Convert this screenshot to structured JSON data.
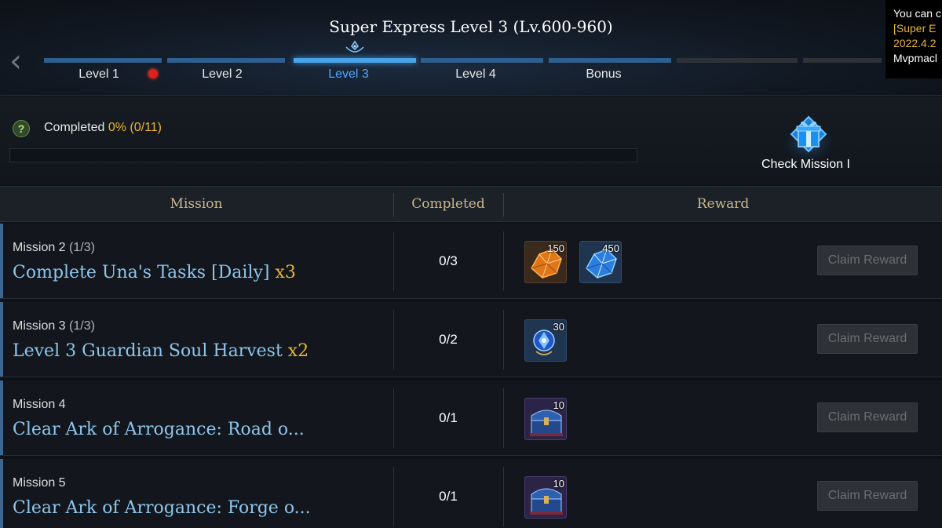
{
  "header": {
    "title": "Super Express Level 3 (Lv.600-960)",
    "back_icon": "chevron-left-icon",
    "tabs": [
      {
        "label": "Level 1",
        "state": "normal",
        "has_alert": true
      },
      {
        "label": "Level 2",
        "state": "normal",
        "has_alert": false
      },
      {
        "label": "Level 3",
        "state": "active",
        "has_alert": false
      },
      {
        "label": "Level 4",
        "state": "normal",
        "has_alert": false
      },
      {
        "label": "Bonus",
        "state": "normal",
        "has_alert": false
      },
      {
        "label": "",
        "state": "locked",
        "has_alert": false
      },
      {
        "label": "",
        "state": "locked",
        "has_alert": false
      }
    ]
  },
  "side_note": {
    "line1": "You can c",
    "line2": "[Super E",
    "line3": "2022.4.2",
    "line4": "Mvpmacl"
  },
  "progress": {
    "label": "Completed",
    "percent_text": "0% (0/11)",
    "fraction": 0,
    "check_mission_label": "Check Mission I"
  },
  "table": {
    "headers": {
      "mission": "Mission",
      "completed": "Completed",
      "reward": "Reward"
    },
    "rows": [
      {
        "mission_name": "Mission 2",
        "mission_progress": "(1/3)",
        "task": "Complete Una's Tasks [Daily]",
        "multiplier": "x3",
        "count": "0/3",
        "rewards": [
          {
            "icon": "orange-crystal-icon",
            "qty": "150"
          },
          {
            "icon": "blue-crystal-icon",
            "qty": "450"
          }
        ],
        "claim_label": "Claim Reward"
      },
      {
        "mission_name": "Mission 3",
        "mission_progress": "(1/3)",
        "task": "Level 3 Guardian Soul Harvest",
        "multiplier": "x2",
        "count": "0/2",
        "rewards": [
          {
            "icon": "guardian-soul-gem-icon",
            "qty": "30"
          }
        ],
        "claim_label": "Claim Reward"
      },
      {
        "mission_name": "Mission 4",
        "mission_progress": "",
        "task": "Clear Ark of Arrogance: Road o...",
        "multiplier": "",
        "count": "0/1",
        "rewards": [
          {
            "icon": "blue-chest-icon",
            "qty": "10"
          }
        ],
        "claim_label": "Claim Reward"
      },
      {
        "mission_name": "Mission 5",
        "mission_progress": "",
        "task": "Clear Ark of Arrogance: Forge o...",
        "multiplier": "",
        "count": "0/1",
        "rewards": [
          {
            "icon": "blue-chest-icon",
            "qty": "10"
          }
        ],
        "claim_label": "Claim Reward"
      }
    ]
  },
  "colors": {
    "accent_gold": "#e8b533",
    "active_blue": "#4ea8ff",
    "task_blue": "#8ec5ec",
    "header_gold": "#c9b78c",
    "alert_red": "#e0201a"
  }
}
